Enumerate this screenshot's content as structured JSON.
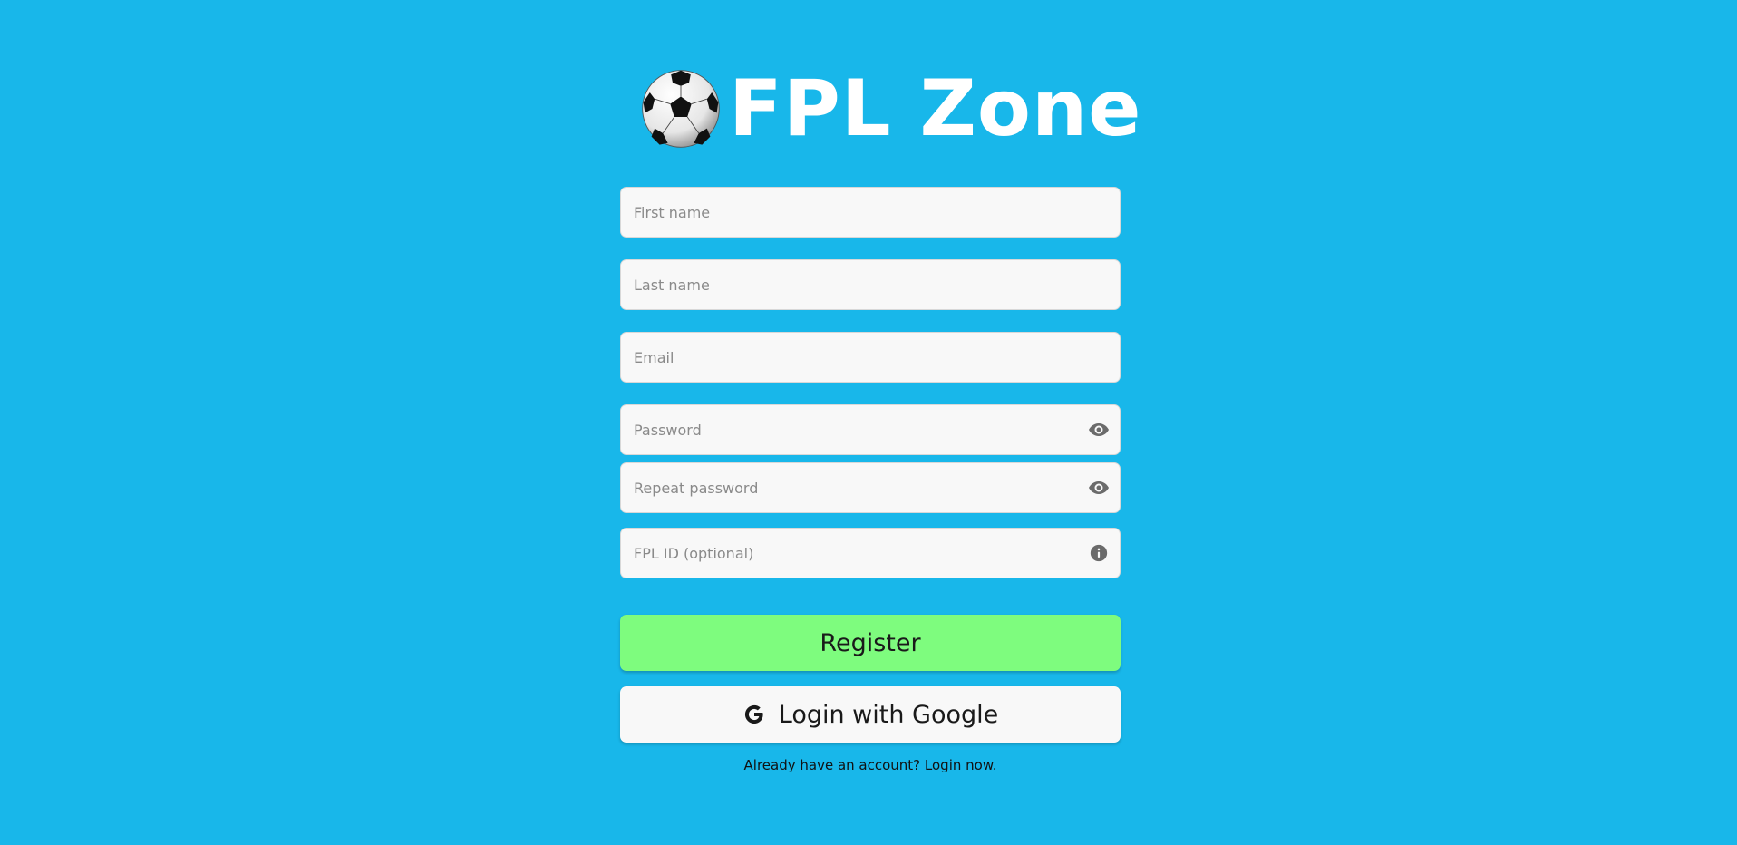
{
  "brand": {
    "title": "FPL Zone",
    "logo_icon": "soccer-ball-icon"
  },
  "form": {
    "first_name": {
      "placeholder": "First name",
      "value": ""
    },
    "last_name": {
      "placeholder": "Last name",
      "value": ""
    },
    "email": {
      "placeholder": "Email",
      "value": ""
    },
    "password": {
      "placeholder": "Password",
      "value": "",
      "trailing_icon": "eye-icon"
    },
    "repeat_password": {
      "placeholder": "Repeat password",
      "value": "",
      "trailing_icon": "eye-icon"
    },
    "fpl_id": {
      "placeholder": "FPL ID (optional)",
      "value": "",
      "trailing_icon": "info-icon"
    }
  },
  "actions": {
    "register_label": "Register",
    "google_label": "Login with Google",
    "google_icon": "google-g-icon",
    "login_prompt": "Already have an account? Login now."
  },
  "colors": {
    "background": "#18b7ea",
    "register_button": "#7efc7e",
    "field_background": "#f8f8f8",
    "title_text": "#ffffff"
  }
}
